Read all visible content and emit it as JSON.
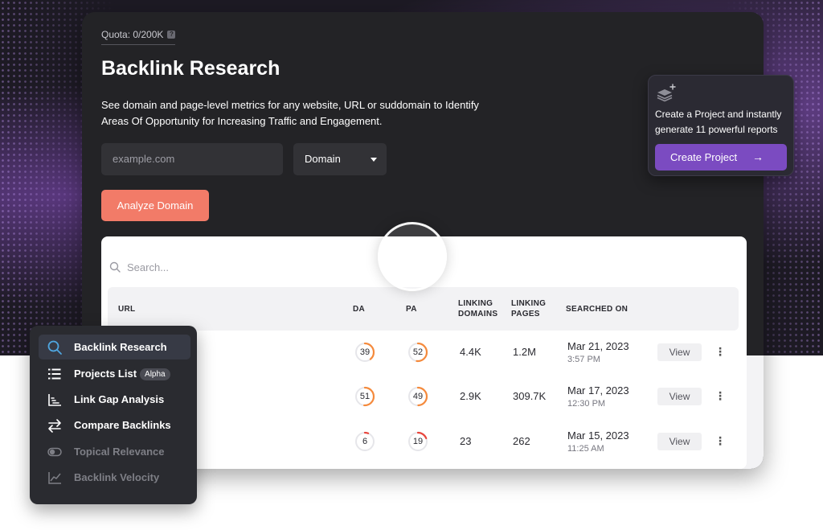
{
  "quota": {
    "label": "Quota: 0/200K",
    "help_icon": "?"
  },
  "page_title": "Backlink Research",
  "description": "See domain and page-level metrics for any website, URL or suddomain to Identify Areas Of Opportunity for Increasing Traffic and Engagement.",
  "search_form": {
    "input_placeholder": "example.com",
    "select_value": "Domain",
    "analyze_button": "Analyze Domain"
  },
  "promo": {
    "icon": "layers-plus-icon",
    "text": "Create a Project and instantly generate 11 powerful reports",
    "button": "Create Project",
    "button_arrow": "→"
  },
  "table": {
    "search_placeholder": "Search...",
    "headers": {
      "url": "URL",
      "da": "DA",
      "pa": "PA",
      "linking_domains": "LINKING DOMAINS",
      "linking_pages": "LINKING PAGES",
      "searched_on": "SEARCHED ON"
    },
    "rows": [
      {
        "da": "39",
        "pa": "52",
        "linking_domains": "4.4K",
        "linking_pages": "1.2M",
        "date": "Mar 21, 2023",
        "time": "3:57 PM",
        "action": "View",
        "da_pct": 0.39,
        "pa_pct": 0.52
      },
      {
        "da": "51",
        "pa": "49",
        "linking_domains": "2.9K",
        "linking_pages": "309.7K",
        "date": "Mar 17, 2023",
        "time": "12:30 PM",
        "action": "View",
        "da_pct": 0.51,
        "pa_pct": 0.49
      },
      {
        "da": "6",
        "pa": "19",
        "linking_domains": "23",
        "linking_pages": "262",
        "date": "Mar 15, 2023",
        "time": "11:25 AM",
        "action": "View",
        "da_pct": 0.06,
        "pa_pct": 0.19
      }
    ]
  },
  "side_menu": {
    "items": [
      {
        "label": "Backlink Research",
        "icon": "search-icon",
        "active": true
      },
      {
        "label": "Projects List",
        "icon": "list-icon",
        "badge": "Alpha"
      },
      {
        "label": "Link Gap Analysis",
        "icon": "gap-chart-icon"
      },
      {
        "label": "Compare Backlinks",
        "icon": "swap-arrows-icon"
      },
      {
        "label": "Topical Relevance",
        "icon": "toggle-icon",
        "disabled": true
      },
      {
        "label": "Backlink Velocity",
        "icon": "trend-chart-icon",
        "disabled": true
      }
    ]
  },
  "colors": {
    "accent_orange": "#f27b68",
    "accent_purple": "#7b4bc1",
    "ring_orange": "#f58a3c",
    "ring_red": "#e8453c",
    "dark_card": "#232326"
  }
}
